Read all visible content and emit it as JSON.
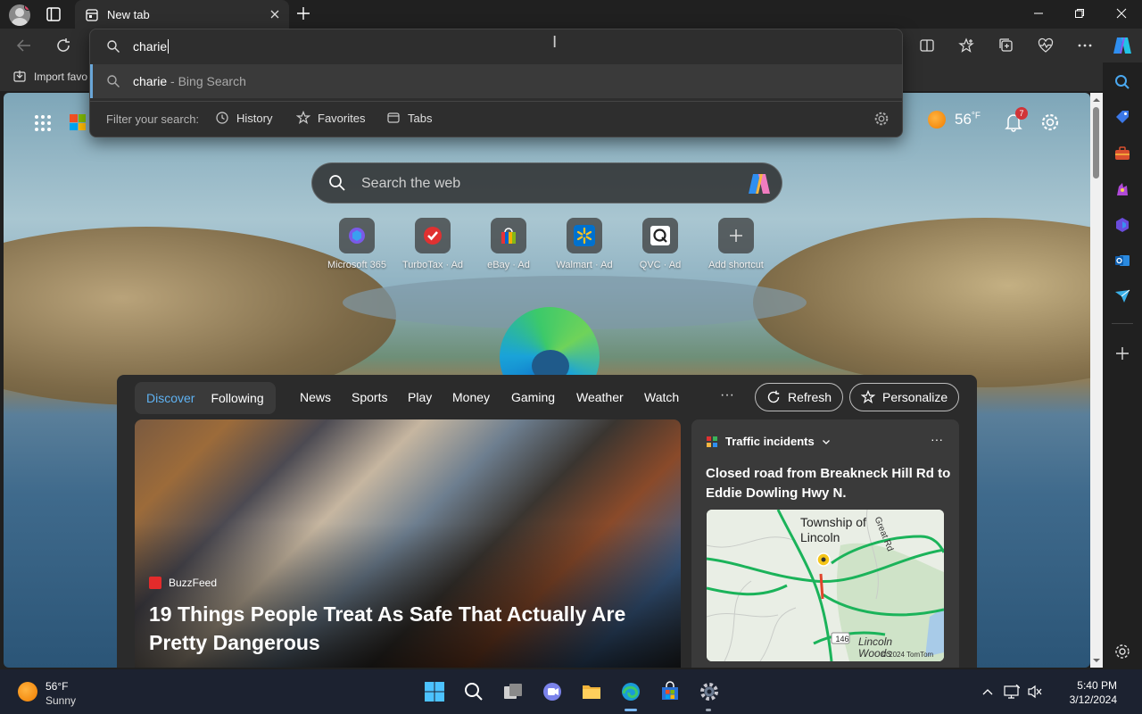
{
  "browser": {
    "tab_title": "New tab",
    "favorites_bar_item": "Import favo"
  },
  "omnibox": {
    "value": "charie",
    "suggestion_query": "charie",
    "suggestion_source": "- Bing Search",
    "filter_label": "Filter your search:",
    "filters": [
      {
        "label": "History",
        "icon": "history-icon"
      },
      {
        "label": "Favorites",
        "icon": "star-icon"
      },
      {
        "label": "Tabs",
        "icon": "tabs-icon"
      }
    ]
  },
  "newtab": {
    "weather_temp": "56",
    "weather_unit": "°F",
    "notification_count": "7",
    "search_placeholder": "Search the web",
    "shortcuts": [
      {
        "label": "Microsoft 365"
      },
      {
        "label": "TurboTax · Ad"
      },
      {
        "label": "eBay · Ad"
      },
      {
        "label": "Walmart · Ad"
      },
      {
        "label": "QVC · Ad"
      },
      {
        "label": "Add shortcut"
      }
    ]
  },
  "feed": {
    "pills": [
      "Discover",
      "Following"
    ],
    "nav": [
      "News",
      "Sports",
      "Play",
      "Money",
      "Gaming",
      "Weather",
      "Watch"
    ],
    "more": "···",
    "refresh_label": "Refresh",
    "personalize_label": "Personalize",
    "main_card": {
      "source": "BuzzFeed",
      "headline": "19 Things People Treat As Safe That Actually Are Pretty Dangerous"
    },
    "side_card": {
      "category": "Traffic incidents",
      "more": "···",
      "title": "Closed road from Breakneck Hill Rd to Eddie Dowling Hwy N.",
      "map_labels": {
        "place": "Township of Lincoln",
        "road": "Great Rd",
        "route": "146",
        "town": "Lincoln Woods",
        "copyright": "© 2024 TomTom"
      }
    }
  },
  "taskbar": {
    "weather_temp": "56°F",
    "weather_cond": "Sunny",
    "time": "5:40 PM",
    "date": "3/12/2024"
  },
  "colors": {
    "accent": "#5fb2f2",
    "chrome_bg": "#202020",
    "toolbar_bg": "#2e2e2e",
    "feed_bg": "#2b2b2b",
    "traffic_green": "#1bb35a"
  }
}
